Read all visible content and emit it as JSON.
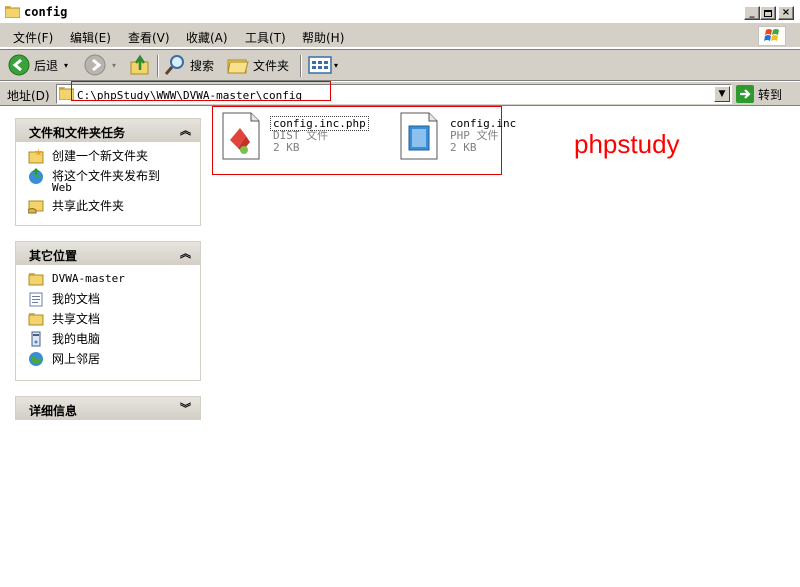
{
  "window": {
    "title": "config"
  },
  "menu": [
    "文件(F)",
    "编辑(E)",
    "查看(V)",
    "收藏(A)",
    "工具(T)",
    "帮助(H)"
  ],
  "toolbar": {
    "back": "后退",
    "search": "搜索",
    "folders": "文件夹"
  },
  "address": {
    "label": "地址(D)",
    "path": "C:\\phpStudy\\WWW\\DVWA-master\\config",
    "goto": "转到"
  },
  "tasks_panel": {
    "title": "文件和文件夹任务",
    "items": [
      "创建一个新文件夹",
      "将这个文件夹发布到",
      "Web",
      "共享此文件夹"
    ]
  },
  "places_panel": {
    "title": "其它位置",
    "items": [
      "DVWA-master",
      "我的文档",
      "共享文档",
      "我的电脑",
      "网上邻居"
    ]
  },
  "details_panel": {
    "title": "详细信息"
  },
  "files": [
    {
      "name": "config.inc.php",
      "type": "DIST 文件",
      "size": "2 KB"
    },
    {
      "name": "config.inc",
      "type": "PHP 文件",
      "size": "2 KB"
    }
  ],
  "annotation": "phpstudy",
  "colors": {
    "annotation": "#ff0000",
    "chrome": "#d4d0c8"
  }
}
